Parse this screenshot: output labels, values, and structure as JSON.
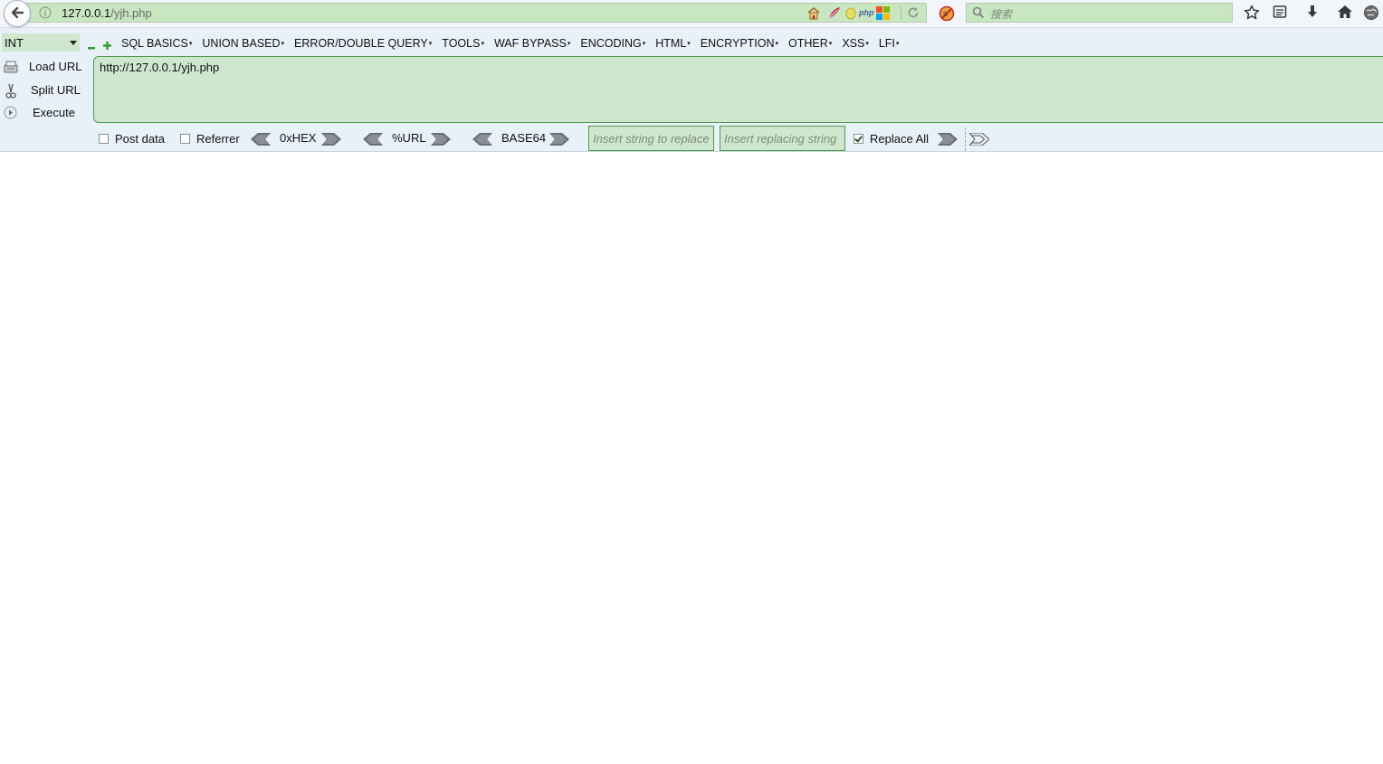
{
  "browser": {
    "url_host": "127.0.0.1",
    "url_path": "/yjh.php",
    "search_placeholder": "搜索"
  },
  "hackbar": {
    "select_value": "INT",
    "menus": [
      {
        "label": "SQL BASICS"
      },
      {
        "label": "UNION BASED"
      },
      {
        "label": "ERROR/DOUBLE QUERY"
      },
      {
        "label": "TOOLS"
      },
      {
        "label": "WAF BYPASS"
      },
      {
        "label": "ENCODING"
      },
      {
        "label": "HTML"
      },
      {
        "label": "ENCRYPTION"
      },
      {
        "label": "OTHER"
      },
      {
        "label": "XSS"
      },
      {
        "label": "LFI"
      }
    ],
    "load_url": "Load URL",
    "split_url": "Split URL",
    "execute": "Execute",
    "url_value": "http://127.0.0.1/yjh.php",
    "post_data": {
      "label": "Post data",
      "checked": false
    },
    "referrer": {
      "label": "Referrer",
      "checked": false
    },
    "hex_label": "0xHEX",
    "urlenc_label": "%URL",
    "base64_label": "BASE64",
    "replace_from_placeholder": "Insert string to replace",
    "replace_to_placeholder": "Insert replacing string",
    "replace_all": {
      "label": "Replace All",
      "checked": true
    }
  },
  "colors": {
    "field_green": "#c8e6c0",
    "hackbar_bg": "#e8f0f8",
    "border_green": "#4e9a4e"
  }
}
